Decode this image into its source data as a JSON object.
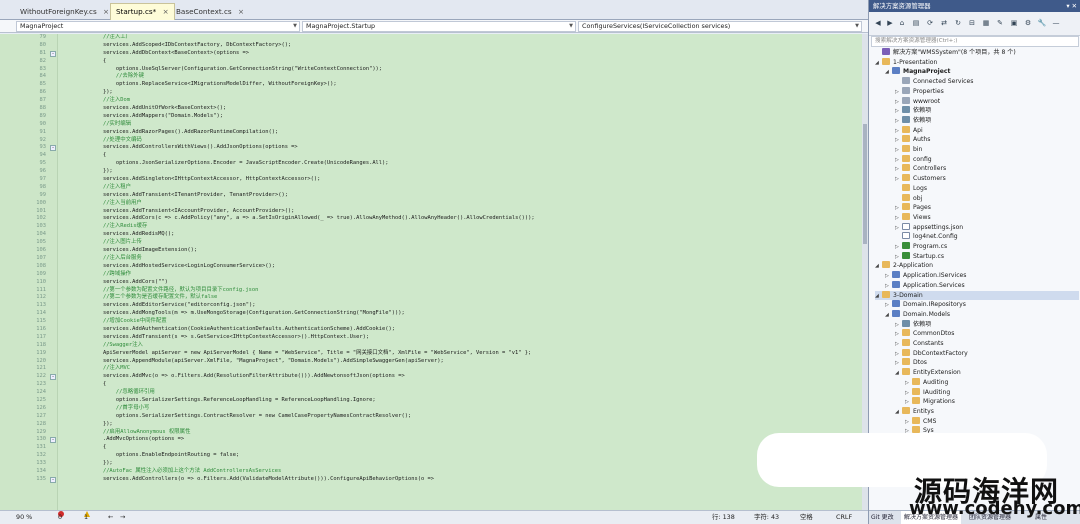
{
  "tabs": [
    {
      "label": "WithoutForeignKey.cs",
      "close": "×"
    },
    {
      "label": "Startup.cs*",
      "close": "×"
    },
    {
      "label": "BaseContext.cs",
      "close": "×"
    }
  ],
  "navbar": {
    "project_dd": "MagnaProject",
    "class_dd": "MagnaProject.Startup",
    "member_dd": "ConfigureServices(IServiceCollection services)"
  },
  "code_lines": [
    {
      "n": "79",
      "t": "            //注入工厂"
    },
    {
      "n": "80",
      "t": "            services.AddScoped<IDbContextFactory, DbContextFactory>();"
    },
    {
      "n": "81",
      "t": "            services.AddDbContext<BaseContext>(options =>"
    },
    {
      "n": "82",
      "t": "            {"
    },
    {
      "n": "83",
      "t": "                options.UseSqlServer(Configuration.GetConnectionString(\"WriteContextConnection\"));"
    },
    {
      "n": "84",
      "t": "                //去除外键"
    },
    {
      "n": "85",
      "t": "                options.ReplaceService<IMigrationsModelDiffer, WithoutForeignKey>();"
    },
    {
      "n": "86",
      "t": "            });"
    },
    {
      "n": "87",
      "t": "            //注入Dom"
    },
    {
      "n": "88",
      "t": "            services.AddUnitOfWork<BaseContext>();"
    },
    {
      "n": "89",
      "t": "            services.AddMappers(\"Domain.Models\");"
    },
    {
      "n": "90",
      "t": "            //实时编辑"
    },
    {
      "n": "91",
      "t": "            services.AddRazorPages().AddRazorRuntimeCompilation();"
    },
    {
      "n": "92",
      "t": "            //处理中文编码"
    },
    {
      "n": "93",
      "t": "            services.AddControllersWithViews().AddJsonOptions(options =>"
    },
    {
      "n": "94",
      "t": "            {"
    },
    {
      "n": "95",
      "t": "                options.JsonSerializerOptions.Encoder = JavaScriptEncoder.Create(UnicodeRanges.All);"
    },
    {
      "n": "96",
      "t": "            });"
    },
    {
      "n": "97",
      "t": "            services.AddSingleton<IHttpContextAccessor, HttpContextAccessor>();"
    },
    {
      "n": "98",
      "t": "            //注入租户"
    },
    {
      "n": "99",
      "t": "            services.AddTransient<ITenantProvider, TenantProvider>();"
    },
    {
      "n": "100",
      "t": "            //注入当前用户"
    },
    {
      "n": "101",
      "t": "            services.AddTransient<IAccountProvider, AccountProvider>();"
    },
    {
      "n": "102",
      "t": "            services.AddCors(c => c.AddPolicy(\"any\", a => a.SetIsOriginAllowed(_ => true).AllowAnyMethod().AllowAnyHeader().AllowCredentials()));"
    },
    {
      "n": "103",
      "t": "            //注入Redis缓存"
    },
    {
      "n": "104",
      "t": "            services.AddRedisMQ();"
    },
    {
      "n": "105",
      "t": "            //注入图片上传"
    },
    {
      "n": "106",
      "t": "            services.AddImageExtension();"
    },
    {
      "n": "107",
      "t": "            //注入后台服务"
    },
    {
      "n": "108",
      "t": "            services.AddHostedService<LoginLogConsumerService>();"
    },
    {
      "n": "109",
      "t": "            //跨域操作"
    },
    {
      "n": "110",
      "t": "            services.AddCors(\"\")"
    },
    {
      "n": "111",
      "t": "            //第一个参数为配置文件路径，默认为项目目录下config.json"
    },
    {
      "n": "112",
      "t": "            //第二个参数为是否缓存配置文件，默认false"
    },
    {
      "n": "113",
      "t": "            services.AddEditorService(\"editorconfig.json\");"
    },
    {
      "n": "114",
      "t": "            services.AddMongTools(m => m.UseMongoStorage(Configuration.GetConnectionString(\"MongFile\")));"
    },
    {
      "n": "115",
      "t": "            //增加Cookie中间件配置"
    },
    {
      "n": "116",
      "t": "            services.AddAuthentication(CookieAuthenticationDefaults.AuthenticationScheme).AddCookie();"
    },
    {
      "n": "117",
      "t": "            services.AddTransient(s => s.GetService<IHttpContextAccessor>().HttpContext.User);"
    },
    {
      "n": "118",
      "t": "            //Swagger注入"
    },
    {
      "n": "119",
      "t": "            ApiServerModel apiServer = new ApiServerModel { Name = \"WebService\", Title = \"网关接口文档\", XmlFile = \"WebService\", Version = \"v1\" };"
    },
    {
      "n": "120",
      "t": "            services.AppendModule(apiServer.XmlFile, \"MagnaProject\", \"Domain.Models\").AddSimpleSwaggerGen(apiServer);"
    },
    {
      "n": "121",
      "t": "            //注入MVC"
    },
    {
      "n": "122",
      "t": "            services.AddMvc(o => o.Filters.Add(ResolutionFilterAttribute())).AddNewtonsoftJson(options =>"
    },
    {
      "n": "123",
      "t": "            {"
    },
    {
      "n": "124",
      "t": "                //忽略循环引用"
    },
    {
      "n": "125",
      "t": "                options.SerializerSettings.ReferenceLoopHandling = ReferenceLoopHandling.Ignore;"
    },
    {
      "n": "126",
      "t": "                //首字母小写"
    },
    {
      "n": "127",
      "t": "                options.SerializerSettings.ContractResolver = new CamelCasePropertyNamesContractResolver();"
    },
    {
      "n": "128",
      "t": "            });"
    },
    {
      "n": "129",
      "t": "            //启用AllowAnonymous 权限属性"
    },
    {
      "n": "130",
      "t": "            .AddMvcOptions(options =>"
    },
    {
      "n": "131",
      "t": "            {"
    },
    {
      "n": "132",
      "t": "                options.EnableEndpointRouting = false;"
    },
    {
      "n": "133",
      "t": "            });"
    },
    {
      "n": "134",
      "t": "            //AutoFac 属性注入必须加上这个方法 AddControllersAsServices"
    },
    {
      "n": "135",
      "t": "            services.AddControllers(o => o.Filters.Add(ValidateModelAttribute())).ConfigureApiBehaviorOptions(o =>"
    }
  ],
  "status_left": {
    "zoom": "90 %",
    "errors": "0",
    "warnings": "1",
    "line": "行: 138",
    "col": "字符: 43",
    "mode": "空格",
    "eol": "CRLF"
  },
  "solex": {
    "title": "解决方案资源管理器",
    "search_placeholder": "搜索解决方案资源管理器(Ctrl+;)",
    "nodes": [
      {
        "label": "解决方案\"WMSSystem\"(8 个项目，共 8 个)",
        "depth": 0,
        "type": "sln",
        "exp": ""
      },
      {
        "label": "1-Presentation",
        "depth": 0,
        "type": "folder",
        "exp": "◢"
      },
      {
        "label": "MagnaProject",
        "depth": 1,
        "type": "proj",
        "exp": "◢",
        "bold": true
      },
      {
        "label": "Connected Services",
        "depth": 2,
        "type": "cfg",
        "exp": ""
      },
      {
        "label": "Properties",
        "depth": 2,
        "type": "cfg",
        "exp": "▷"
      },
      {
        "label": "wwwroot",
        "depth": 2,
        "type": "cfg",
        "exp": "▷"
      },
      {
        "label": "依赖项",
        "depth": 2,
        "type": "ref",
        "exp": "▷"
      },
      {
        "label": "依赖项",
        "depth": 2,
        "type": "ref",
        "exp": "▷"
      },
      {
        "label": "Api",
        "depth": 2,
        "type": "folder",
        "exp": "▷"
      },
      {
        "label": "Auths",
        "depth": 2,
        "type": "folder",
        "exp": "▷"
      },
      {
        "label": "bin",
        "depth": 2,
        "type": "folder",
        "exp": "▷"
      },
      {
        "label": "config",
        "depth": 2,
        "type": "folder",
        "exp": "▷"
      },
      {
        "label": "Controllers",
        "depth": 2,
        "type": "folder",
        "exp": "▷"
      },
      {
        "label": "Customers",
        "depth": 2,
        "type": "folder",
        "exp": "▷"
      },
      {
        "label": "Logs",
        "depth": 2,
        "type": "folder",
        "exp": ""
      },
      {
        "label": "obj",
        "depth": 2,
        "type": "folder",
        "exp": ""
      },
      {
        "label": "Pages",
        "depth": 2,
        "type": "folder",
        "exp": "▷"
      },
      {
        "label": "Views",
        "depth": 2,
        "type": "folder",
        "exp": "▷"
      },
      {
        "label": "appsettings.json",
        "depth": 2,
        "type": "file",
        "exp": "▷"
      },
      {
        "label": "log4net.Config",
        "depth": 2,
        "type": "file",
        "exp": ""
      },
      {
        "label": "Program.cs",
        "depth": 2,
        "type": "cs",
        "exp": "▷"
      },
      {
        "label": "Startup.cs",
        "depth": 2,
        "type": "cs",
        "exp": "▷"
      },
      {
        "label": "2-Application",
        "depth": 0,
        "type": "folder",
        "exp": "◢"
      },
      {
        "label": "Application.IServices",
        "depth": 1,
        "type": "proj",
        "exp": "▷"
      },
      {
        "label": "Application.Services",
        "depth": 1,
        "type": "proj",
        "exp": "▷"
      },
      {
        "label": "3-Domain",
        "depth": 0,
        "type": "folder",
        "exp": "◢",
        "selected": true
      },
      {
        "label": "Domain.IRepositorys",
        "depth": 1,
        "type": "proj",
        "exp": "▷"
      },
      {
        "label": "Domain.Models",
        "depth": 1,
        "type": "proj",
        "exp": "◢"
      },
      {
        "label": "依赖项",
        "depth": 2,
        "type": "ref",
        "exp": "▷"
      },
      {
        "label": "CommonDtos",
        "depth": 2,
        "type": "folder",
        "exp": "▷"
      },
      {
        "label": "Constants",
        "depth": 2,
        "type": "folder",
        "exp": "▷"
      },
      {
        "label": "DbContextFactory",
        "depth": 2,
        "type": "folder",
        "exp": "▷"
      },
      {
        "label": "Dtos",
        "depth": 2,
        "type": "folder",
        "exp": "▷"
      },
      {
        "label": "EntityExtension",
        "depth": 2,
        "type": "folder",
        "exp": "◢"
      },
      {
        "label": "Auditing",
        "depth": 3,
        "type": "folder",
        "exp": "▷"
      },
      {
        "label": "IAuditing",
        "depth": 3,
        "type": "folder",
        "exp": "▷"
      },
      {
        "label": "Migrations",
        "depth": 3,
        "type": "folder",
        "exp": "▷"
      },
      {
        "label": "Entitys",
        "depth": 2,
        "type": "folder",
        "exp": "◢"
      },
      {
        "label": "CMS",
        "depth": 3,
        "type": "folder",
        "exp": "▷"
      },
      {
        "label": "Sys",
        "depth": 3,
        "type": "folder",
        "exp": "▷"
      }
    ],
    "status": {
      "git": "Git 更改",
      "solex_tab": "解决方案资源管理器",
      "team_tab": "团队资源管理器",
      "extra": "属性"
    }
  },
  "watermark": {
    "line1": "源码海洋网",
    "line2": "www.codehy.com"
  }
}
